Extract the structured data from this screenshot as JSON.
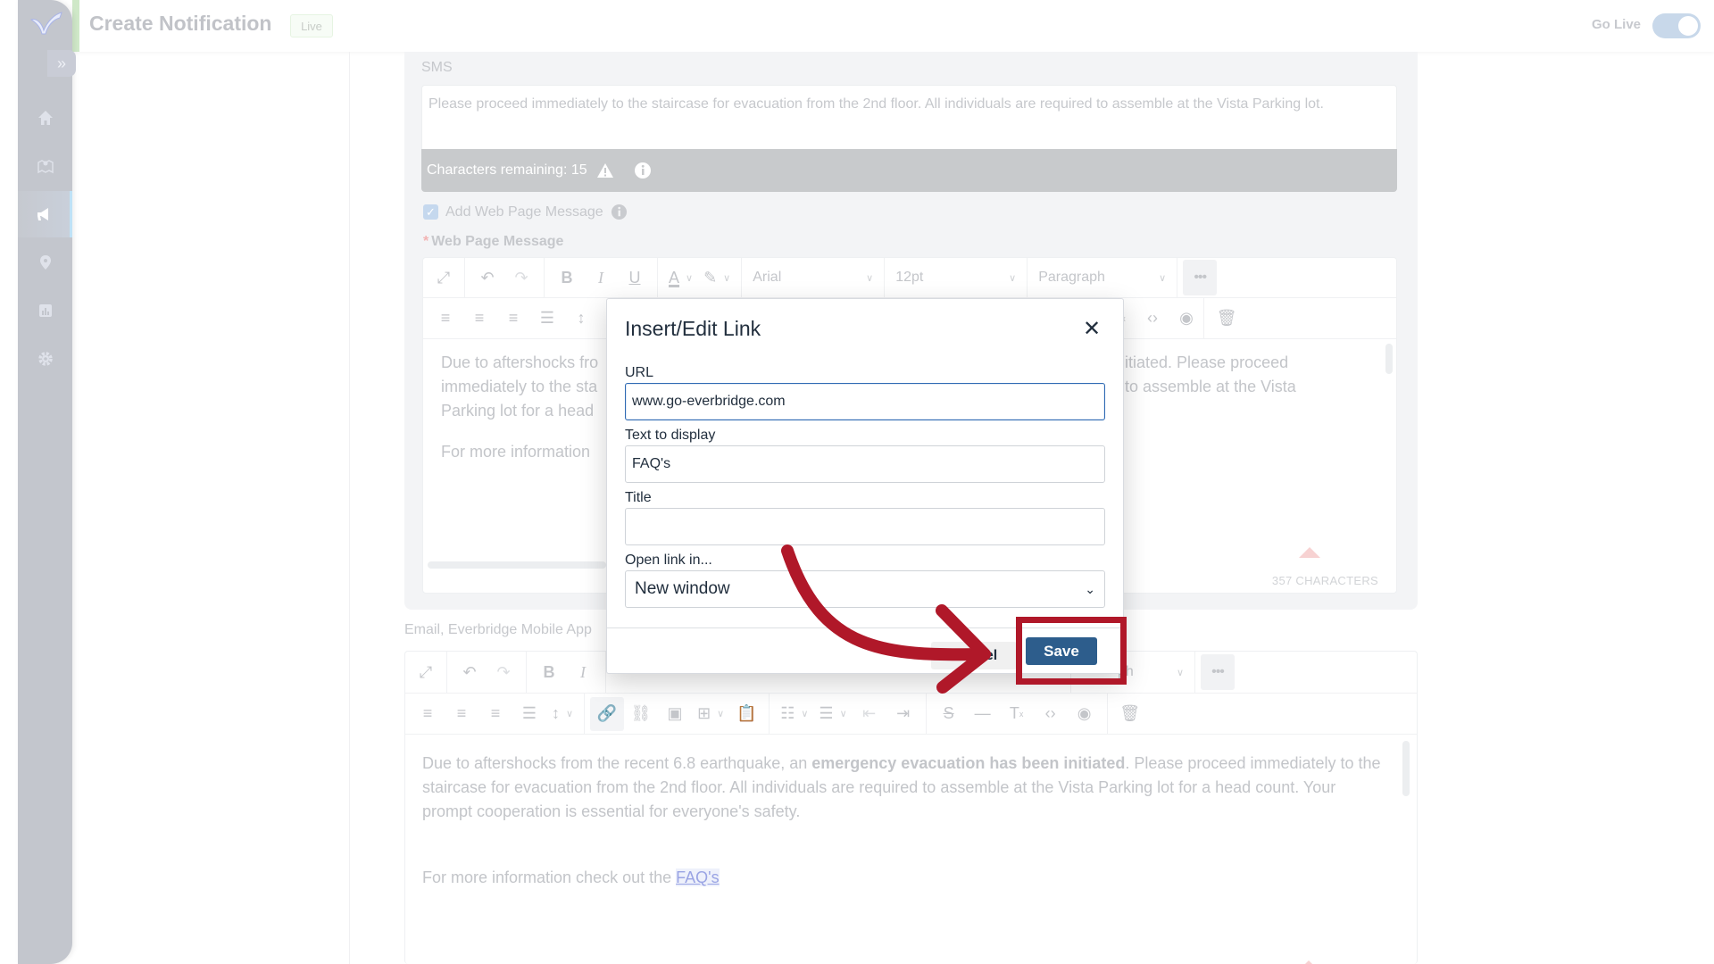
{
  "header": {
    "title": "Create Notification",
    "status_badge": "Live",
    "go_live_label": "Go Live",
    "go_live_on": true
  },
  "sidebar": {
    "expand_label": "»",
    "items": [
      {
        "name": "home",
        "icon": "home-icon"
      },
      {
        "name": "map",
        "icon": "map-icon"
      },
      {
        "name": "notifications",
        "icon": "megaphone-icon",
        "active": true
      },
      {
        "name": "location",
        "icon": "location-pin-icon"
      },
      {
        "name": "reports",
        "icon": "chart-icon"
      },
      {
        "name": "settings",
        "icon": "gear-icon"
      }
    ]
  },
  "sms": {
    "label": "SMS",
    "text": "Please proceed immediately to the staircase for evacuation from the 2nd floor. All individuals are required to assemble at the Vista Parking lot.",
    "chars_remaining": "Characters remaining: 15"
  },
  "web_page": {
    "checkbox_label": "Add Web Page Message",
    "checked": true,
    "required_marker": "*",
    "label": "Web Page Message"
  },
  "editor_toolbar": {
    "font": "Arial",
    "size": "12pt",
    "block": "Paragraph",
    "more": "•••"
  },
  "editor1": {
    "line1_visible": "Due to aftershocks fro",
    "line1_right": "itiated. Please proceed",
    "line2_visible": "immediately to the sta",
    "line2_right": "to assemble at the Vista",
    "line3_visible": "Parking lot for a head",
    "para2_visible": "For more information",
    "status": "357 CHARACTERS"
  },
  "email": {
    "label": "Email, Everbridge Mobile App"
  },
  "editor2": {
    "text_pre": "Due to aftershocks from the recent 6.8 earthquake, an ",
    "text_bold": "emergency evacuation has been initiated",
    "text_post": ". Please proceed immediately to the staircase for evacuation from the 2nd floor. All individuals are required to assemble at the Vista Parking lot for a head count. Your prompt cooperation is essential for everyone's safety.",
    "para2_pre": "For more information check out the ",
    "para2_link": "FAQ's"
  },
  "dialog": {
    "title": "Insert/Edit Link",
    "close": "✕",
    "url_label": "URL",
    "url_value": "www.go-everbridge.com",
    "text_label": "Text to display",
    "text_value": "FAQ's",
    "title_label": "Title",
    "title_value": "",
    "target_label": "Open link in...",
    "target_value": "New window",
    "cancel": "Cancel",
    "save": "Save"
  },
  "annotation": {
    "color": "#b01829",
    "target": "Save"
  }
}
